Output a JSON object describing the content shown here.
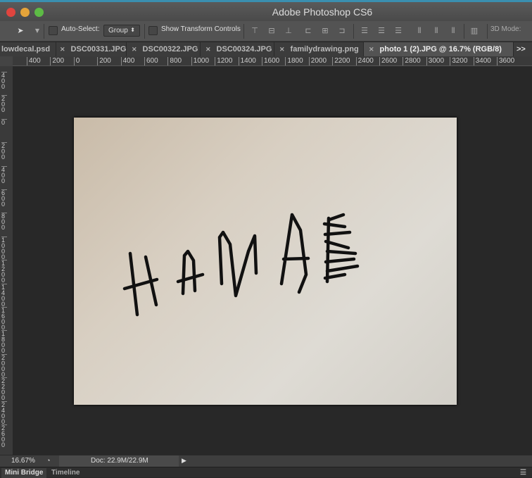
{
  "app": {
    "title": "Adobe Photoshop CS6"
  },
  "options_bar": {
    "auto_select_label": "Auto-Select:",
    "auto_select_checked": false,
    "auto_select_value": "Group",
    "show_transform_label": "Show Transform Controls",
    "show_transform_checked": false,
    "mode_3d_label": "3D Mode:"
  },
  "tabs": [
    {
      "label": "lowdecal.psd"
    },
    {
      "label": "DSC00331.JPG"
    },
    {
      "label": "DSC00322.JPG"
    },
    {
      "label": "DSC00324.JPG"
    },
    {
      "label": "familydrawing.png"
    },
    {
      "label": "photo 1 (2).JPG @ 16.7% (RGB/8)",
      "active": true
    }
  ],
  "tabs_overflow": ">>",
  "hruler": [
    "400",
    "200",
    "0",
    "200",
    "400",
    "600",
    "800",
    "1000",
    "1200",
    "1400",
    "1600",
    "1800",
    "2000",
    "2200",
    "2400",
    "2600",
    "2800",
    "3000",
    "3200",
    "3400",
    "3600"
  ],
  "vruler": [
    "400",
    "200",
    "0",
    "200",
    "400",
    "600",
    "800",
    "1000",
    "1200",
    "1400",
    "1600",
    "1800",
    "2000",
    "2200",
    "2400",
    "2600"
  ],
  "status": {
    "zoom": "16.67%",
    "doc": "Doc: 22.9M/22.9M"
  },
  "bottom_tabs": [
    {
      "label": "Mini Bridge",
      "active": true
    },
    {
      "label": "Timeline"
    }
  ],
  "colors": {
    "close": "#e0443e",
    "minimize": "#e5a43a",
    "zoom": "#5dbb45",
    "paper": "#d8d2c8",
    "ink": "#111111"
  }
}
